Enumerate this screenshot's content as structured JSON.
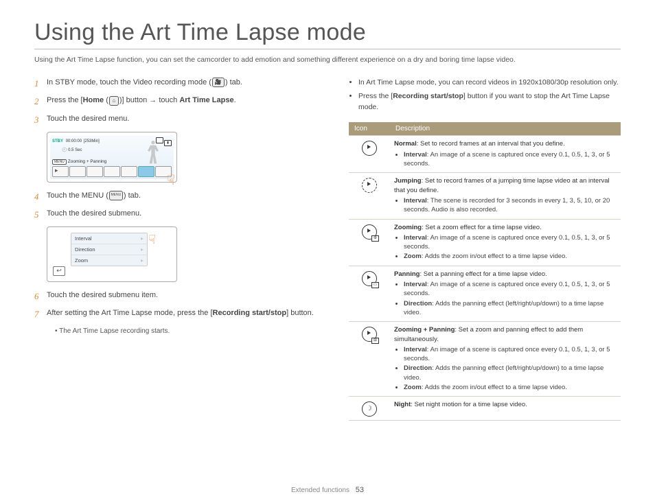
{
  "title": "Using the Art Time Lapse mode",
  "intro": "Using the Art Time Lapse function, you can set the camcorder to add emotion and something different experience on a dry and boring time lapse video.",
  "steps": {
    "s1_a": "In STBY mode, touch the Video recording mode (",
    "s1_b": ") tab.",
    "s2_a": "Press the [",
    "s2_home": "Home",
    "s2_b": " (",
    "s2_c": ")] button → touch ",
    "s2_atl": "Art Time Lapse",
    "s2_d": ".",
    "s3": "Touch the desired menu.",
    "s4_a": "Touch the MENU (",
    "s4_icon": "MENU",
    "s4_b": ") tab.",
    "s5": "Touch the desired submenu.",
    "s6": "Touch the desired submenu item.",
    "s7_a": "After setting the Art Time Lapse mode, press the [",
    "s7_b": "Recording start/stop",
    "s7_c": "] button.",
    "s7_sub": "The Art Time Lapse recording starts."
  },
  "screenshot1": {
    "stby": "STBY",
    "time": "00:00:00",
    "remain": "[253Min]",
    "sec": "0.5 Sec",
    "menu_chip": "MENU",
    "mode_line": "Zooming + Panning"
  },
  "screenshot2": {
    "items": [
      "Interval",
      "Direction",
      "Zoom"
    ],
    "back": "↩"
  },
  "right_bullets": [
    "In Art Time Lapse mode, you can record videos in 1920x1080/30p resolution only.",
    "Press the [<b>Recording start/stop</b>] button if you want to stop the Art Time Lapse mode."
  ],
  "table": {
    "head_icon": "Icon",
    "head_desc": "Description",
    "rows": [
      {
        "icon": "normal",
        "headline": "<b>Normal</b>: Set to record frames at an interval that you define.",
        "bullets": [
          "<b>Interval</b>: An image of a scene is captured once every 0.1, 0.5, 1, 3, or 5 seconds."
        ]
      },
      {
        "icon": "jumping",
        "headline": "<b>Jumping</b>: Set to record frames of a jumping time lapse video at an interval that you define.",
        "bullets": [
          "<b>Interval</b>: The scene is recorded for 3 seconds in every 1, 3, 5, 10, or 20 seconds. Audio is also recorded."
        ]
      },
      {
        "icon": "zooming",
        "headline": "<b>Zooming</b>: Set a zoom effect for a time lapse video.",
        "bullets": [
          "<b>Interval</b>: An image of a scene is captured once every 0.1, 0.5, 1, 3, or 5 seconds.",
          "<b>Zoom</b>: Adds the zoom in/out effect to a time lapse video."
        ]
      },
      {
        "icon": "panning",
        "headline": "<b>Panning</b>: Set a panning effect for a time lapse video.",
        "bullets": [
          "<b>Interval</b>: An image of a scene is captured once every 0.1, 0.5, 1, 3, or 5 seconds.",
          "<b>Direction</b>: Adds the panning effect (left/right/up/down) to a time lapse video."
        ]
      },
      {
        "icon": "zoompan",
        "headline": "<b>Zooming + Panning</b>: Set a zoom and panning effect to add them simultaneously.",
        "bullets": [
          "<b>Interval</b>: An image of a scene is captured once every 0.1, 0.5, 1, 3, or 5 seconds.",
          "<b>Direction</b>: Adds the panning effect (left/right/up/down) to a time lapse video.",
          "<b>Zoom</b>: Adds the zoom in/out effect to a time lapse video."
        ]
      },
      {
        "icon": "night",
        "headline": "<b>Night</b>: Set night motion for a time lapse video.",
        "bullets": []
      }
    ]
  },
  "footer": {
    "section": "Extended functions",
    "page": "53"
  }
}
